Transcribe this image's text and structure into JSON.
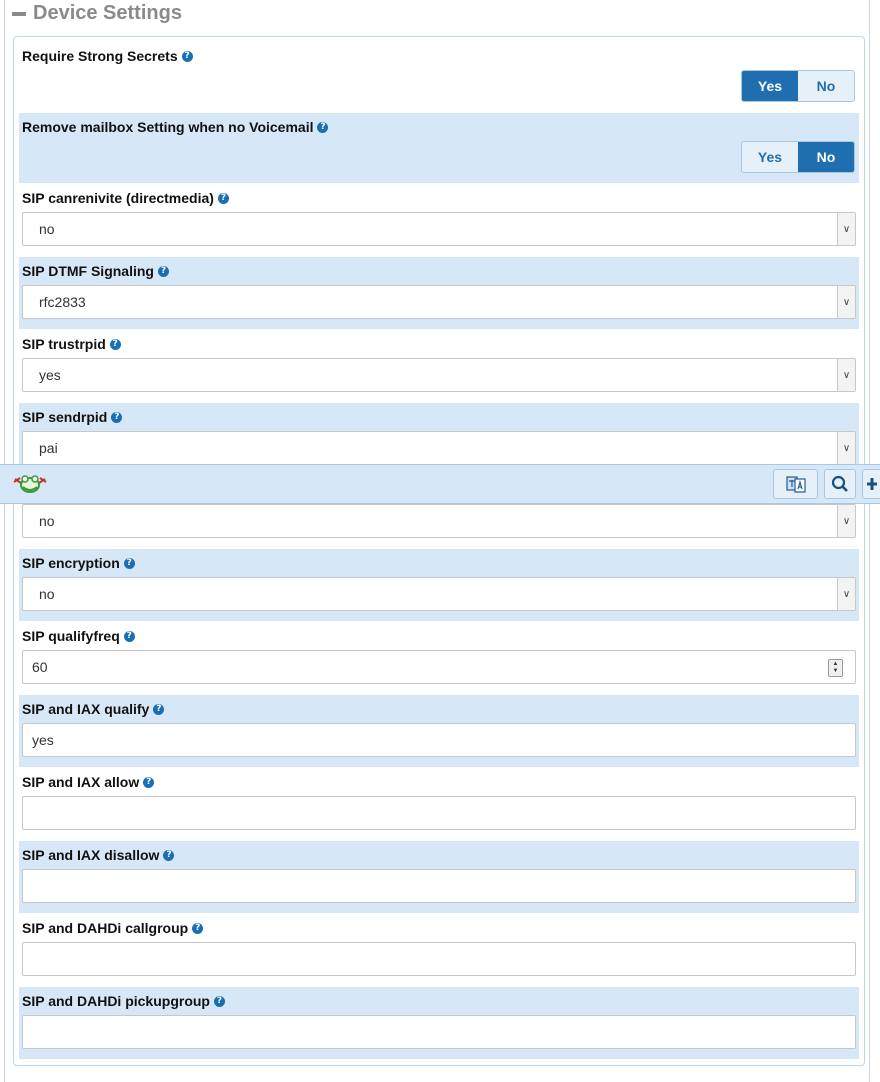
{
  "section": {
    "title": "Device Settings"
  },
  "settings": [
    {
      "label": "Require Strong Secrets",
      "type": "toggle",
      "yes": "Yes",
      "no": "No",
      "selected": "Yes"
    },
    {
      "label": "Remove mailbox Setting when no Voicemail",
      "type": "toggle",
      "yes": "Yes",
      "no": "No",
      "selected": "No"
    },
    {
      "label": "SIP canrenivite (directmedia)",
      "type": "select",
      "value": "no"
    },
    {
      "label": "SIP DTMF Signaling",
      "type": "select",
      "value": "rfc2833"
    },
    {
      "label": "SIP trustrpid",
      "type": "select",
      "value": "yes"
    },
    {
      "label": "SIP sendrpid",
      "type": "select",
      "value": "pai"
    },
    {
      "label": "",
      "type": "select",
      "value": "no"
    },
    {
      "label": "SIP encryption",
      "type": "select",
      "value": "no"
    },
    {
      "label": "SIP qualifyfreq",
      "type": "number",
      "value": "60"
    },
    {
      "label": "SIP and IAX qualify",
      "type": "text",
      "value": "yes"
    },
    {
      "label": "SIP and IAX allow",
      "type": "text",
      "value": ""
    },
    {
      "label": "SIP and IAX disallow",
      "type": "text",
      "value": ""
    },
    {
      "label": "SIP and DAHDi callgroup",
      "type": "text",
      "value": ""
    },
    {
      "label": "SIP and DAHDi pickupgroup",
      "type": "text",
      "value": ""
    }
  ],
  "toolbar": {
    "icons": [
      "frog-logo-icon",
      "translate-icon",
      "search-icon",
      "plus-icon"
    ]
  },
  "colors": {
    "accent": "#1f6fb0",
    "row_shade": "#d6e8f7",
    "header_gray": "#8a8a8a"
  }
}
